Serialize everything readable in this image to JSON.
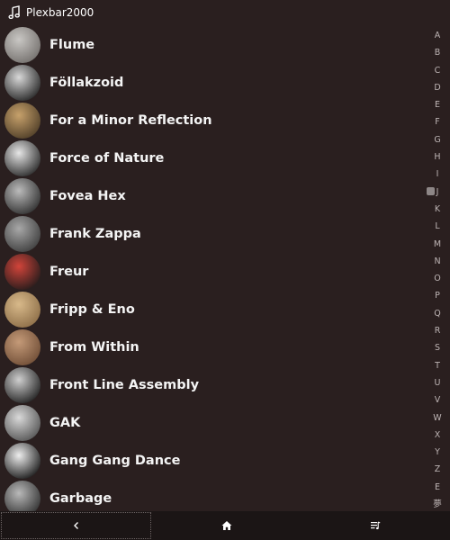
{
  "app": {
    "title": "Plexbar2000",
    "title_icon": "music-note-icon"
  },
  "artists": [
    {
      "name": "Flume",
      "avatar_colors": [
        "#c9c7c4",
        "#716d6a"
      ]
    },
    {
      "name": "Föllakzoid",
      "avatar_colors": [
        "#d8d8d8",
        "#1f1f1f"
      ]
    },
    {
      "name": "For a Minor Reflection",
      "avatar_colors": [
        "#c7a16b",
        "#4a3a25"
      ]
    },
    {
      "name": "Force of Nature",
      "avatar_colors": [
        "#e6e6e6",
        "#222222"
      ]
    },
    {
      "name": "Fovea Hex",
      "avatar_colors": [
        "#bbbbbb",
        "#2a2a2a"
      ]
    },
    {
      "name": "Frank Zappa",
      "avatar_colors": [
        "#a8a8a8",
        "#3a3a3a"
      ]
    },
    {
      "name": "Freur",
      "avatar_colors": [
        "#d1443a",
        "#1e1a1a"
      ]
    },
    {
      "name": "Fripp & Eno",
      "avatar_colors": [
        "#d8b98a",
        "#8a6b45"
      ]
    },
    {
      "name": "From Within",
      "avatar_colors": [
        "#c49a78",
        "#6d4b34"
      ]
    },
    {
      "name": "Front Line Assembly",
      "avatar_colors": [
        "#cfcfcf",
        "#1a1a1a"
      ]
    },
    {
      "name": "GAK",
      "avatar_colors": [
        "#d9d9d9",
        "#4f4f4f"
      ]
    },
    {
      "name": "Gang Gang Dance",
      "avatar_colors": [
        "#eeeeee",
        "#111111"
      ]
    },
    {
      "name": "Garbage",
      "avatar_colors": [
        "#b9b9b9",
        "#2b2b2b"
      ]
    }
  ],
  "alphabet": [
    "A",
    "B",
    "C",
    "D",
    "E",
    "F",
    "G",
    "H",
    "I",
    "J",
    "K",
    "L",
    "M",
    "N",
    "O",
    "P",
    "Q",
    "R",
    "S",
    "T",
    "U",
    "V",
    "W",
    "X",
    "Y",
    "Z",
    "E",
    "夢"
  ],
  "nav": {
    "back_icon": "chevron-left-icon",
    "home_icon": "home-icon",
    "queue_icon": "playlist-icon"
  },
  "colors": {
    "background": "#2a1f1f",
    "bottom_bar": "#1b1515",
    "text": "#f4f4f4",
    "index_text": "#bdb4b4"
  }
}
